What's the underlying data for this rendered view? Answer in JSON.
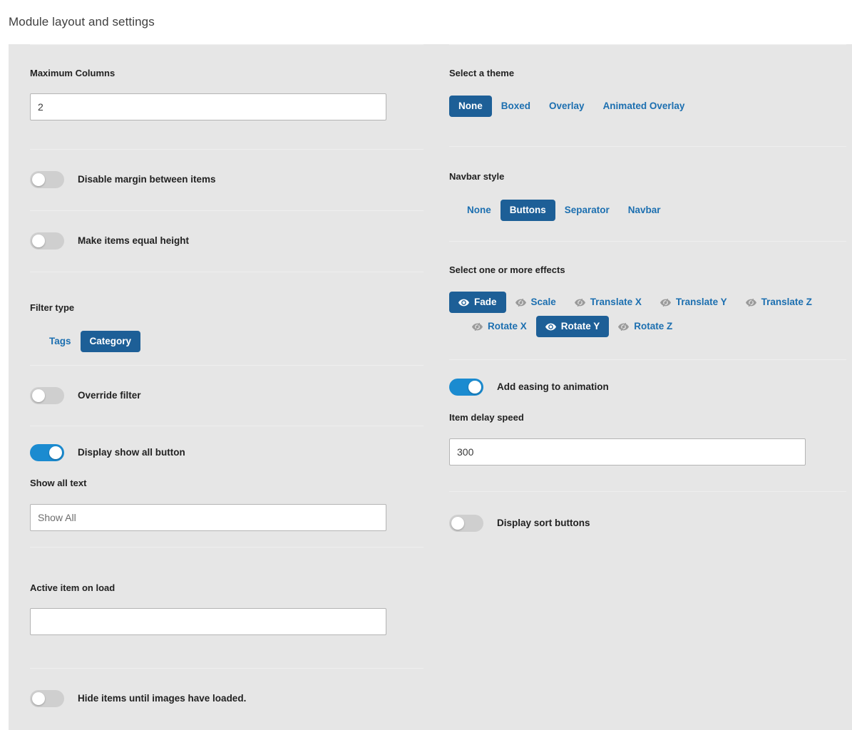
{
  "header": {
    "title": "Module layout and settings"
  },
  "left": {
    "max_columns": {
      "label": "Maximum Columns",
      "value": "2"
    },
    "disable_margin": {
      "label": "Disable margin between items",
      "on": false
    },
    "equal_height": {
      "label": "Make items equal height",
      "on": false
    },
    "filter_type": {
      "label": "Filter type",
      "options": [
        "Tags",
        "Category"
      ],
      "selected": "Category"
    },
    "override_filter": {
      "label": "Override filter",
      "on": false
    },
    "display_show_all": {
      "label": "Display show all button",
      "on": true
    },
    "show_all_text": {
      "label": "Show all text",
      "value": "",
      "placeholder": "Show All"
    },
    "active_item_on_load": {
      "label": "Active item on load",
      "value": "",
      "placeholder": ""
    },
    "hide_until_loaded": {
      "label": "Hide items until images have loaded.",
      "on": false
    }
  },
  "right": {
    "theme": {
      "label": "Select a theme",
      "options": [
        "None",
        "Boxed",
        "Overlay",
        "Animated Overlay"
      ],
      "selected": "None"
    },
    "navbar_style": {
      "label": "Navbar style",
      "options": [
        "None",
        "Buttons",
        "Separator",
        "Navbar"
      ],
      "selected": "Buttons"
    },
    "effects": {
      "label": "Select one or more effects",
      "row1": [
        {
          "label": "Fade",
          "selected": true
        },
        {
          "label": "Scale",
          "selected": false
        },
        {
          "label": "Translate X",
          "selected": false
        },
        {
          "label": "Translate Y",
          "selected": false
        },
        {
          "label": "Translate Z",
          "selected": false
        }
      ],
      "row2": [
        {
          "label": "Rotate X",
          "selected": false
        },
        {
          "label": "Rotate Y",
          "selected": true
        },
        {
          "label": "Rotate Z",
          "selected": false
        }
      ],
      "icon_on": "eye-icon",
      "icon_off": "eye-slash-icon"
    },
    "add_easing": {
      "label": "Add easing to animation",
      "on": true
    },
    "item_delay_speed": {
      "label": "Item delay speed",
      "value": "300",
      "placeholder": ""
    },
    "display_sort_buttons": {
      "label": "Display sort buttons",
      "on": false
    }
  },
  "colors": {
    "panel_bg": "#e6e6e6",
    "accent_selected": "#1d5f97",
    "accent_link": "#1c6fb0",
    "toggle_on": "#1b8bd0",
    "toggle_off": "#cfcfcf",
    "divider": "#efefef"
  }
}
